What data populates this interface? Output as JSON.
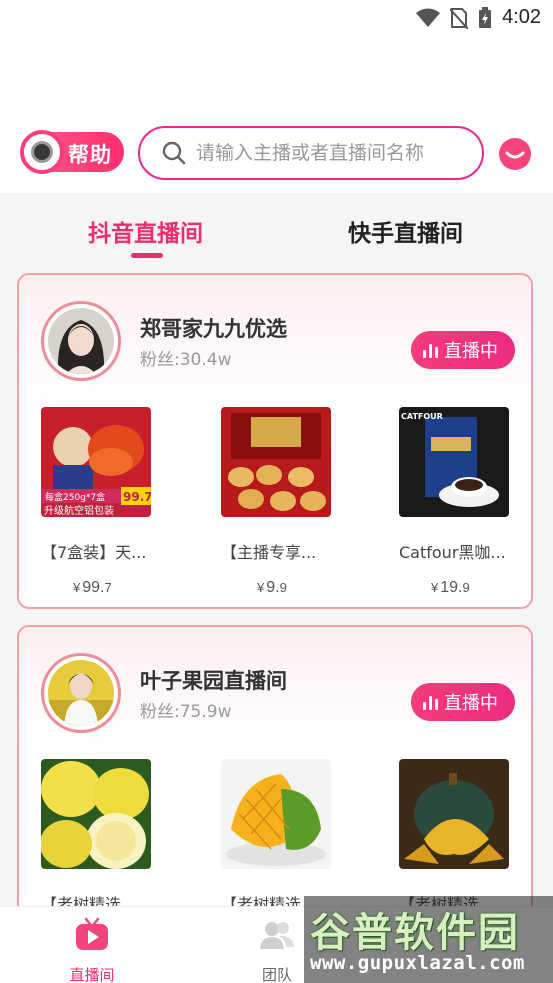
{
  "status_bar": {
    "time": "4:02",
    "icons": [
      "wifi-icon",
      "no-sim-icon",
      "battery-charging-icon"
    ]
  },
  "header": {
    "help_label": "帮助",
    "search_placeholder": "请输入主播或者直播间名称",
    "icons": [
      "help-eye-icon",
      "search-icon",
      "message-icon"
    ]
  },
  "tabs": [
    {
      "label": "抖音直播间",
      "active": true
    },
    {
      "label": "快手直播间",
      "active": false
    }
  ],
  "rooms": [
    {
      "name": "郑哥家九九优选",
      "fans": "粉丝:30.4w",
      "live_label": "直播中",
      "products": [
        {
          "title": "【7盒装】天...",
          "yen": "¥",
          "price_int": "99.",
          "price_dec": "7"
        },
        {
          "title": "【主播专享...",
          "yen": "¥",
          "price_int": "9.",
          "price_dec": "9"
        },
        {
          "title": "Catfour黑咖...",
          "yen": "¥",
          "price_int": "19.",
          "price_dec": "9"
        }
      ]
    },
    {
      "name": "叶子果园直播间",
      "fans": "粉丝:75.9w",
      "live_label": "直播中",
      "products": [
        {
          "title": "【老树精选...",
          "yen": "",
          "price_int": "",
          "price_dec": ""
        },
        {
          "title": "【老树精选...",
          "yen": "",
          "price_int": "",
          "price_dec": ""
        },
        {
          "title": "【老树精选...",
          "yen": "",
          "price_int": "",
          "price_dec": ""
        }
      ]
    }
  ],
  "product_image_text": {
    "crayfish_banner": "每盒250g*7盒",
    "crayfish_badge": "升级航空铝包装",
    "crayfish_price": "99.7",
    "coffee_brand": "CATFOUR"
  },
  "bottom_nav": [
    {
      "label": "直播间",
      "active": true,
      "icon": "live-tv-icon"
    },
    {
      "label": "团队",
      "active": false,
      "icon": "team-icon"
    }
  ],
  "watermark": {
    "title": "谷普软件园",
    "url": "www.gupuxlazal.com"
  },
  "colors": {
    "accent": "#ef2d6c",
    "card_border": "#f2a0a8",
    "search_border": "#e8288a"
  }
}
